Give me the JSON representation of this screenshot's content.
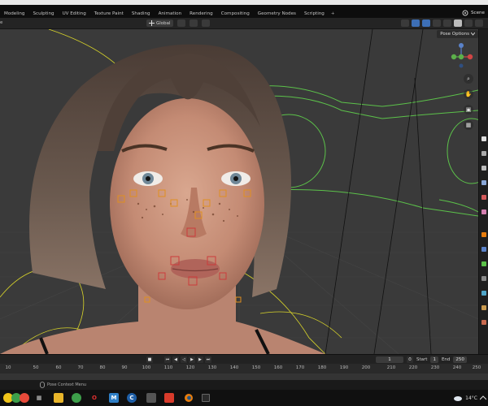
{
  "topbar": {
    "tabs": [
      "Modeling",
      "Sculpting",
      "UV Editing",
      "Texture Paint",
      "Shading",
      "Animation",
      "Rendering",
      "Compositing",
      "Geometry Nodes",
      "Scripting"
    ],
    "add_tab": "+",
    "scene_label": "Scene"
  },
  "header": {
    "left_label": "e",
    "transform_orientation": "Global"
  },
  "viewport": {
    "pose_options": "Pose Options"
  },
  "timeline": {
    "current_frame": "1",
    "start_label": "Start",
    "start_value": "1",
    "end_label": "End",
    "end_value": "250"
  },
  "ruler": {
    "ticks": [
      "10",
      "50",
      "60",
      "70",
      "80",
      "90",
      "100",
      "110",
      "120",
      "130",
      "140",
      "150",
      "160",
      "170",
      "180",
      "190",
      "200",
      "210",
      "220",
      "230",
      "240",
      "250"
    ]
  },
  "statusbar": {
    "hint": "Pose Context Menu"
  },
  "taskbar": {
    "weather": "14°C"
  },
  "colors": {
    "blender_orange": "#e87d0d",
    "rig_yellow": "#d8d42a",
    "rig_green": "#5cc24a",
    "accent_blue": "#3d6fb6"
  }
}
